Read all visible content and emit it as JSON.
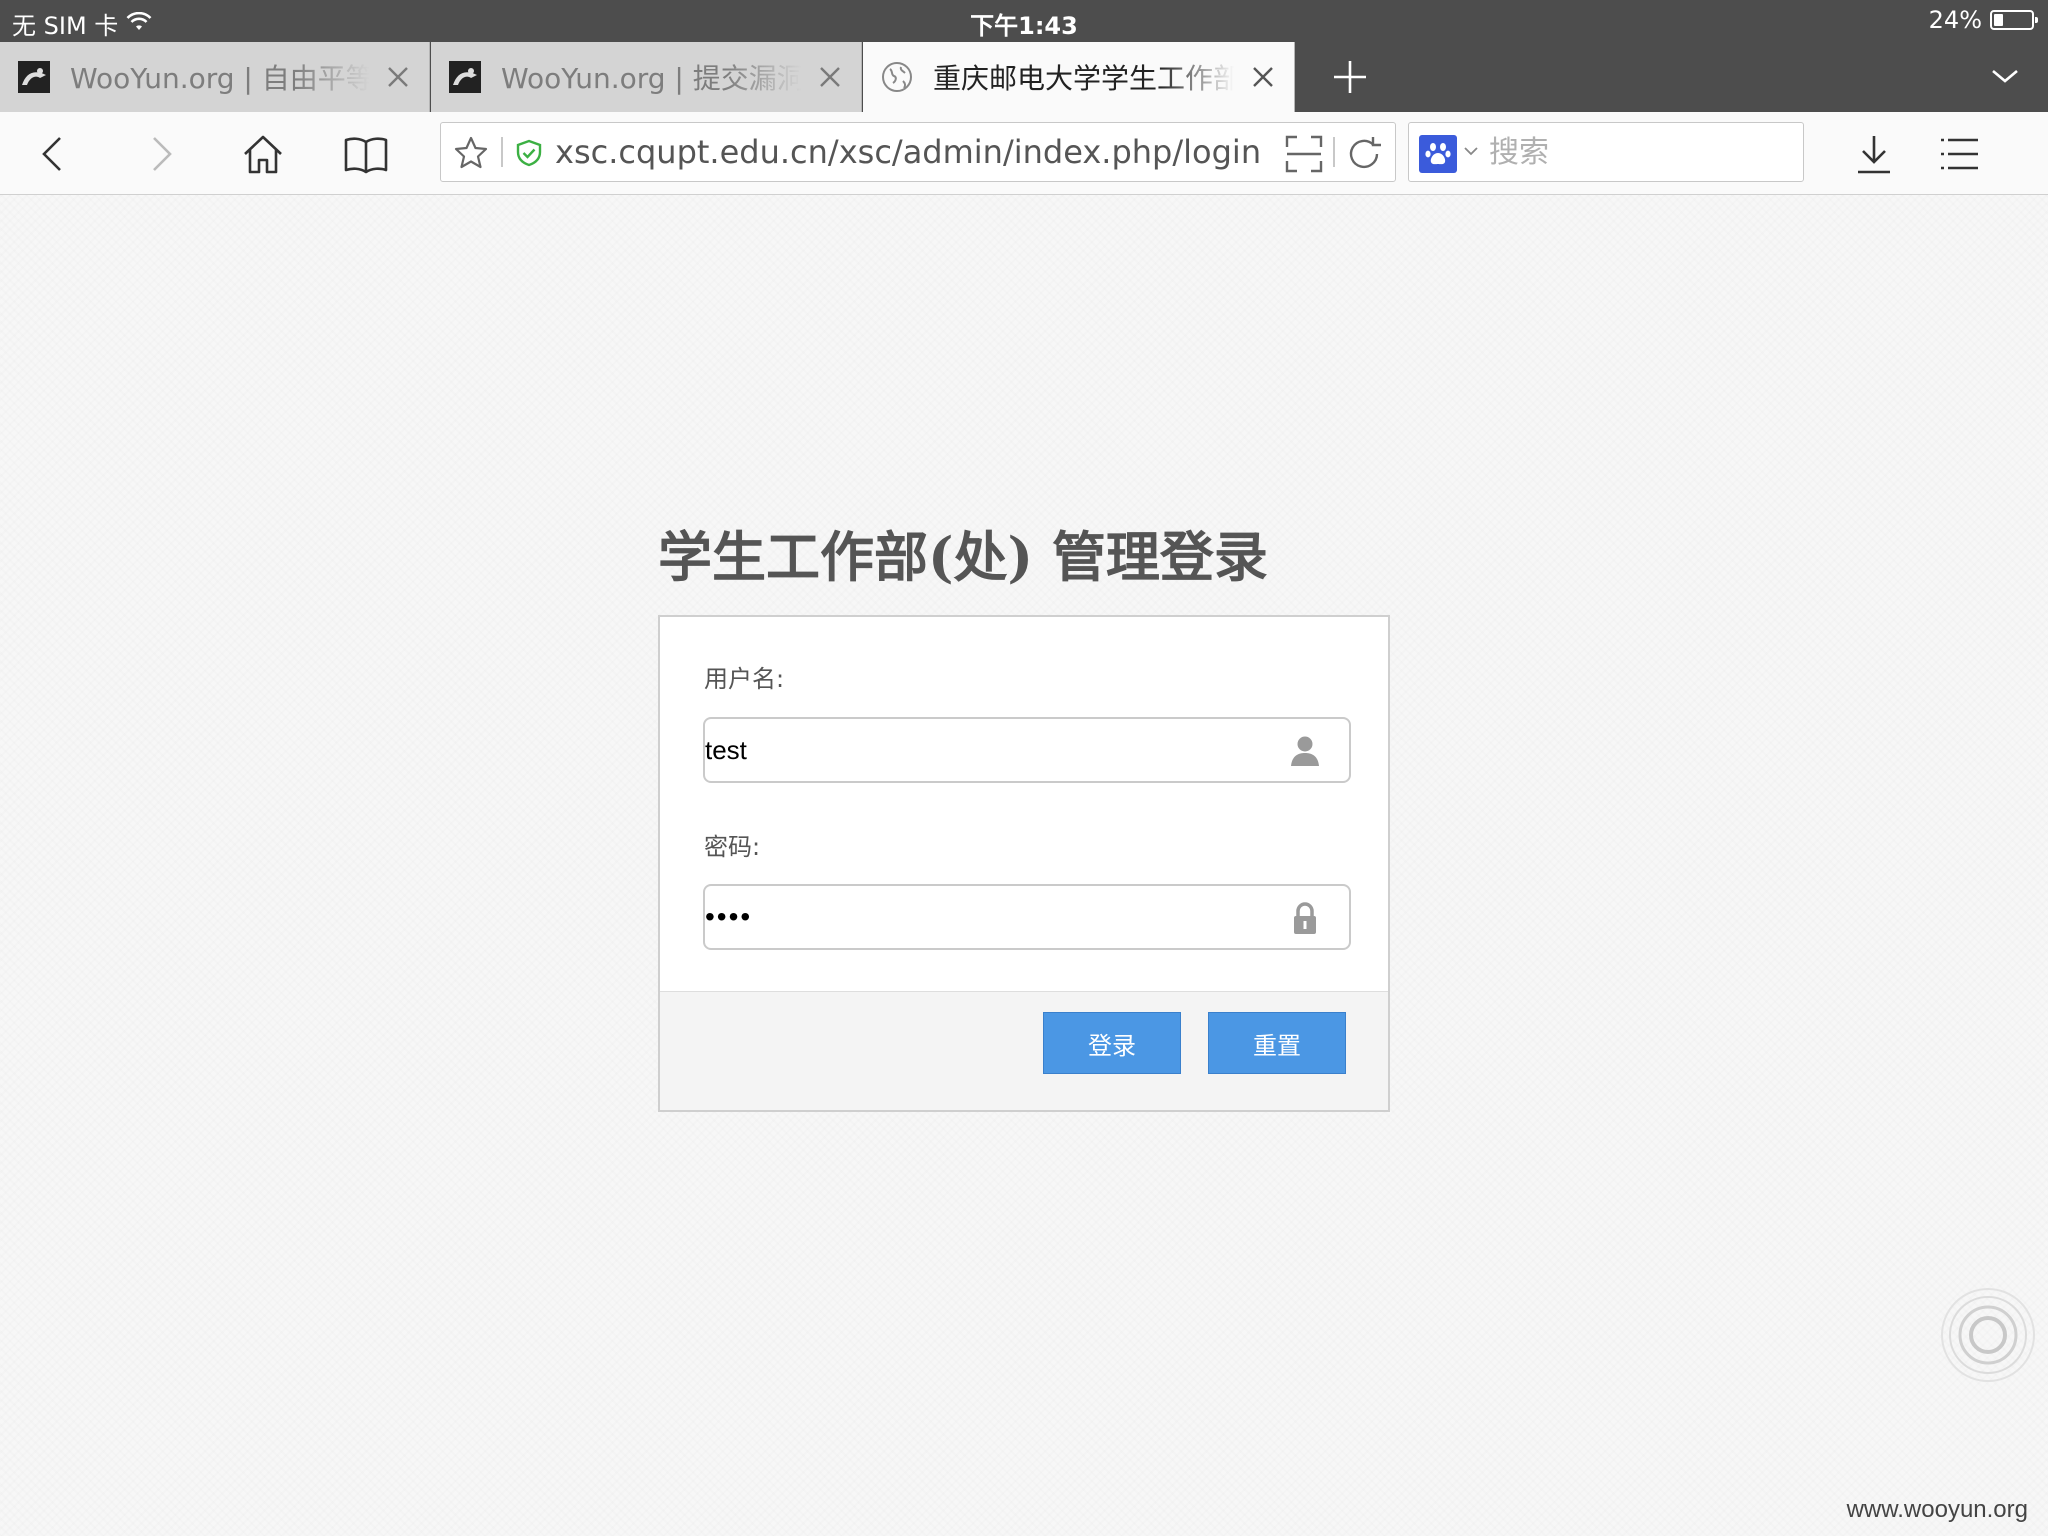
{
  "status_bar": {
    "carrier": "无 SIM 卡",
    "time": "下午1:43",
    "battery_text": "24%",
    "battery_level": 0.24
  },
  "tabs": [
    {
      "title": "WooYun.org | 自由平等开放的漏洞报告平台",
      "active": false,
      "icon": "wooyun-favicon"
    },
    {
      "title": "WooYun.org | 提交漏洞",
      "active": false,
      "icon": "wooyun-favicon"
    },
    {
      "title": "重庆邮电大学学生工作部",
      "active": true,
      "icon": "globe-icon"
    }
  ],
  "toolbar": {
    "url": "xsc.cqupt.edu.cn/xsc/admin/index.php/login",
    "search_placeholder": "搜索"
  },
  "login": {
    "title": "学生工作部(处) 管理登录",
    "username_label": "用户名:",
    "username_value": "test",
    "password_label": "密码:",
    "password_value": "test",
    "submit_label": "登录",
    "reset_label": "重置"
  },
  "watermark": "www.wooyun.org",
  "colors": {
    "accent": "#4b97e4",
    "status_bar": "#4d4d4d",
    "secure_green": "#3cb043"
  }
}
